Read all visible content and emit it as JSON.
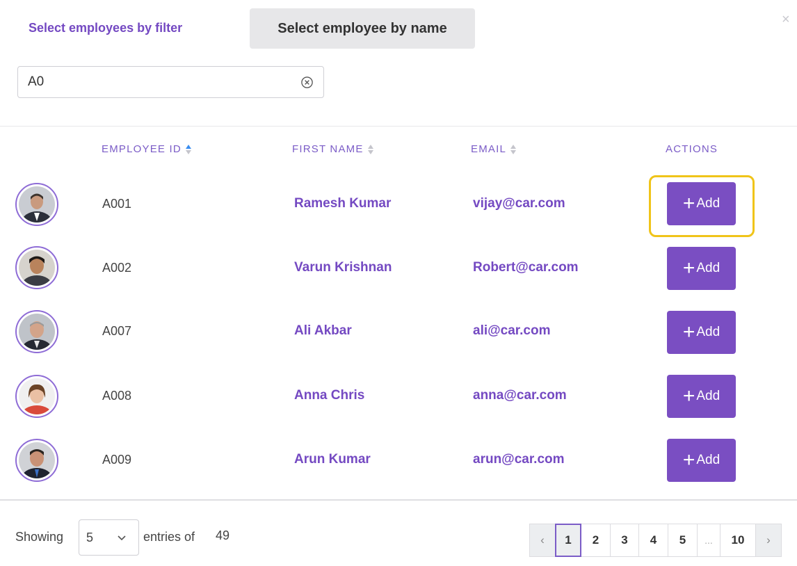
{
  "dialog": {
    "close_label": "×"
  },
  "tabs": {
    "filter_label": "Select employees by filter",
    "name_label": "Select employee by name"
  },
  "search": {
    "value": "A0",
    "placeholder": ""
  },
  "table": {
    "headers": {
      "employee_id": "EMPLOYEE ID",
      "first_name": "FIRST NAME",
      "email": "EMAIL",
      "actions": "ACTIONS"
    },
    "add_label": "Add",
    "rows": [
      {
        "id": "A001",
        "name": "Ramesh Kumar",
        "email": "vijay@car.com"
      },
      {
        "id": "A002",
        "name": "Varun Krishnan",
        "email": "Robert@car.com"
      },
      {
        "id": "A007",
        "name": "Ali Akbar",
        "email": "ali@car.com"
      },
      {
        "id": "A008",
        "name": "Anna Chris",
        "email": "anna@car.com"
      },
      {
        "id": "A009",
        "name": "Arun Kumar",
        "email": "arun@car.com"
      }
    ]
  },
  "footer": {
    "showing_label": "Showing",
    "page_size": "5",
    "entries_label": "entries of",
    "total": "49"
  },
  "pagination": {
    "prev": "‹",
    "pages": [
      "1",
      "2",
      "3",
      "4",
      "5"
    ],
    "ellipsis": "...",
    "last": "10",
    "next": "›",
    "current": "1"
  },
  "colors": {
    "accent": "#7a4ec2",
    "highlight": "#f0c419"
  }
}
